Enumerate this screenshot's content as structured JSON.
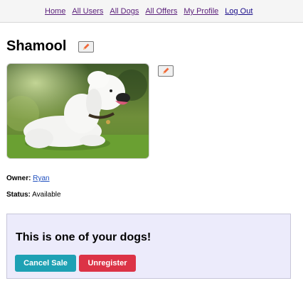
{
  "nav": {
    "items": [
      "Home",
      "All Users",
      "All Dogs",
      "All Offers",
      "My Profile",
      "Log Out"
    ]
  },
  "dog": {
    "name": "Shamool",
    "owner_label": "Owner:",
    "owner_name": "Ryan",
    "status_label": "Status:",
    "status_value": "Available",
    "photo_alt": "white poodle"
  },
  "panel": {
    "message": "This is one of your dogs!",
    "cancel_label": "Cancel Sale",
    "unregister_label": "Unregister"
  },
  "icons": {
    "edit": "pencil-icon"
  },
  "colors": {
    "panel_bg": "#ecebfb",
    "cancel_btn": "#1ea1b4",
    "unregister_btn": "#dc3346",
    "link": "#1f4fbf"
  }
}
